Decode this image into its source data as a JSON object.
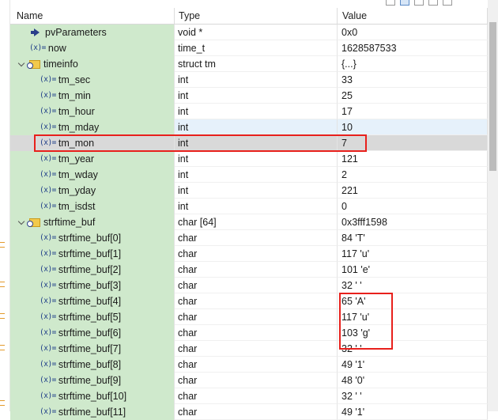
{
  "columns": {
    "name": "Name",
    "type": "Type",
    "value": "Value"
  },
  "rows": [
    {
      "name": "pvParameters",
      "type": "void *",
      "value": "0x0",
      "icon": "pointer-arrow-icon",
      "level": 1
    },
    {
      "name": "now",
      "type": "time_t",
      "value": "1628587533",
      "icon": "variable-icon",
      "level": 1
    },
    {
      "name": "timeinfo",
      "type": "struct tm",
      "value": "{...}",
      "icon": "struct-icon",
      "level": 1,
      "expanded": true
    },
    {
      "name": "tm_sec",
      "type": "int",
      "value": "33",
      "icon": "variable-icon",
      "level": 2
    },
    {
      "name": "tm_min",
      "type": "int",
      "value": "25",
      "icon": "variable-icon",
      "level": 2
    },
    {
      "name": "tm_hour",
      "type": "int",
      "value": "17",
      "icon": "variable-icon",
      "level": 2
    },
    {
      "name": "tm_mday",
      "type": "int",
      "value": "10",
      "icon": "variable-icon",
      "level": 2,
      "state": "hover"
    },
    {
      "name": "tm_mon",
      "type": "int",
      "value": "7",
      "icon": "variable-icon",
      "level": 2,
      "state": "selected"
    },
    {
      "name": "tm_year",
      "type": "int",
      "value": "121",
      "icon": "variable-icon",
      "level": 2
    },
    {
      "name": "tm_wday",
      "type": "int",
      "value": "2",
      "icon": "variable-icon",
      "level": 2
    },
    {
      "name": "tm_yday",
      "type": "int",
      "value": "221",
      "icon": "variable-icon",
      "level": 2
    },
    {
      "name": "tm_isdst",
      "type": "int",
      "value": "0",
      "icon": "variable-icon",
      "level": 2
    },
    {
      "name": "strftime_buf",
      "type": "char [64]",
      "value": "0x3fff1598",
      "icon": "struct-icon",
      "level": 1,
      "expanded": true
    },
    {
      "name": "strftime_buf[0]",
      "type": "char",
      "value": "84 'T'",
      "icon": "variable-icon",
      "level": 2
    },
    {
      "name": "strftime_buf[1]",
      "type": "char",
      "value": "117 'u'",
      "icon": "variable-icon",
      "level": 2
    },
    {
      "name": "strftime_buf[2]",
      "type": "char",
      "value": "101 'e'",
      "icon": "variable-icon",
      "level": 2
    },
    {
      "name": "strftime_buf[3]",
      "type": "char",
      "value": "32 ' '",
      "icon": "variable-icon",
      "level": 2
    },
    {
      "name": "strftime_buf[4]",
      "type": "char",
      "value": "65 'A'",
      "icon": "variable-icon",
      "level": 2
    },
    {
      "name": "strftime_buf[5]",
      "type": "char",
      "value": "117 'u'",
      "icon": "variable-icon",
      "level": 2
    },
    {
      "name": "strftime_buf[6]",
      "type": "char",
      "value": "103 'g'",
      "icon": "variable-icon",
      "level": 2
    },
    {
      "name": "strftime_buf[7]",
      "type": "char",
      "value": "32 ' '",
      "icon": "variable-icon",
      "level": 2
    },
    {
      "name": "strftime_buf[8]",
      "type": "char",
      "value": "49 '1'",
      "icon": "variable-icon",
      "level": 2
    },
    {
      "name": "strftime_buf[9]",
      "type": "char",
      "value": "48 '0'",
      "icon": "variable-icon",
      "level": 2
    },
    {
      "name": "strftime_buf[10]",
      "type": "char",
      "value": "32 ' '",
      "icon": "variable-icon",
      "level": 2
    },
    {
      "name": "strftime_buf[11]",
      "type": "char",
      "value": "49 '1'",
      "icon": "variable-icon",
      "level": 2
    }
  ],
  "variable_icon_text": "(x)=",
  "colors": {
    "name_column_bg": "#cfe9cc",
    "selected_row_bg": "#d9d9d9",
    "hover_row_bg": "#e6f1fb",
    "annotation_red": "#e8201c"
  }
}
